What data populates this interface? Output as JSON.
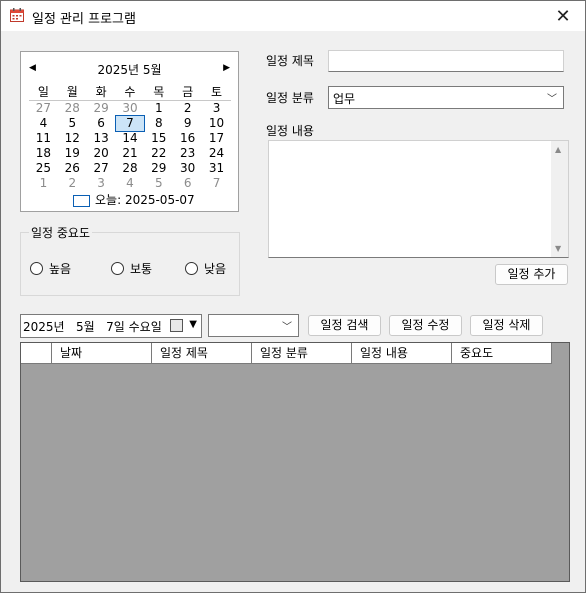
{
  "window": {
    "title": "일정 관리 프로그램",
    "app_icon": "calendar-icon",
    "close_icon": "close-icon"
  },
  "calendar": {
    "prev_icon": "◀",
    "next_icon": "▶",
    "month_label": "2025년 5월",
    "weekdays": [
      "일",
      "월",
      "화",
      "수",
      "목",
      "금",
      "토"
    ],
    "weeks": [
      [
        "27",
        "28",
        "29",
        "30",
        "1",
        "2",
        "3"
      ],
      [
        "4",
        "5",
        "6",
        "7",
        "8",
        "9",
        "10"
      ],
      [
        "11",
        "12",
        "13",
        "14",
        "15",
        "16",
        "17"
      ],
      [
        "18",
        "19",
        "20",
        "21",
        "22",
        "23",
        "24"
      ],
      [
        "25",
        "26",
        "27",
        "28",
        "29",
        "30",
        "31"
      ],
      [
        "1",
        "2",
        "3",
        "4",
        "5",
        "6",
        "7"
      ]
    ],
    "dim_weeks": [
      [
        0,
        1,
        2,
        3
      ],
      [],
      [],
      [],
      [],
      [
        0,
        1,
        2,
        3,
        4,
        5,
        6
      ]
    ],
    "selected": [
      1,
      3
    ],
    "today_label": "오늘: 2025-05-07"
  },
  "form": {
    "title_label": "일정 제목",
    "title_value": "",
    "category_label": "일정 분류",
    "category_value": "업무",
    "content_label": "일정 내용",
    "add_button": "일정 추가"
  },
  "priority": {
    "group_label": "일정 중요도",
    "options": [
      "높음",
      "보통",
      "낮음"
    ]
  },
  "toolbar": {
    "date_value": "2025년   5월   7일 수요일",
    "filter_value": "",
    "search_button": "일정 검색",
    "edit_button": "일정 수정",
    "delete_button": "일정 삭제"
  },
  "table": {
    "columns": [
      "",
      "날짜",
      "일정 제목",
      "일정 분류",
      "일정 내용",
      "중요도"
    ]
  }
}
